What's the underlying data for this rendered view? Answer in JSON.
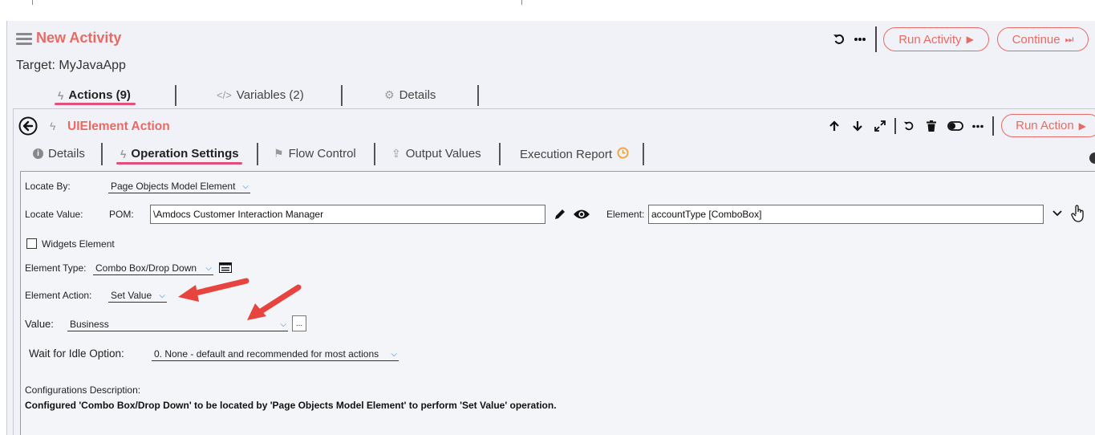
{
  "activity": {
    "title": "New Activity",
    "target": "Target: MyJavaApp",
    "undo_icon": "undo-icon",
    "more_icon": "more-horizontal-icon",
    "run_activity_label": "Run Activity",
    "continue_label": "Continue",
    "tabs": [
      {
        "label": "Actions (9)",
        "icon": "lightning-icon",
        "active": true
      },
      {
        "label": "Variables (2)",
        "icon": "code-icon",
        "active": false
      },
      {
        "label": "Details",
        "icon": "gear-icon",
        "active": false
      }
    ]
  },
  "action": {
    "title": "UIElement Action",
    "run_action_label": "Run Action",
    "toolbar_icons": [
      "arrow-up-icon",
      "arrow-down-icon",
      "expand-icon",
      "undo-icon",
      "trash-icon",
      "toggle-icon",
      "more-horizontal-icon"
    ],
    "tabs": [
      {
        "label": "Details",
        "icon": "info-icon",
        "active": false
      },
      {
        "label": "Operation Settings",
        "icon": "lightning-icon",
        "active": true
      },
      {
        "label": "Flow Control",
        "icon": "signpost-icon",
        "active": false
      },
      {
        "label": "Output Values",
        "icon": "upload-icon",
        "active": false
      },
      {
        "label": "Execution Report",
        "icon": "clock-icon",
        "active": false
      }
    ]
  },
  "form": {
    "locate_by_label": "Locate By:",
    "locate_by_value": "Page Objects Model Element",
    "locate_value_label": "Locate Value:",
    "pom_label": "POM:",
    "pom_value": "\\Amdocs Customer Interaction Manager",
    "element_label": "Element:",
    "element_value": "accountType [ComboBox]",
    "widgets_label": "Widgets Element",
    "widgets_checked": false,
    "element_type_label": "Element Type:",
    "element_type_value": "Combo Box/Drop Down",
    "element_action_label": "Element Action:",
    "element_action_value": "Set Value",
    "value_label": "Value:",
    "value_value": "Business",
    "value_ellipsis": "...",
    "wait_label": "Wait for Idle Option:",
    "wait_value": "0. None - default and recommended for most actions",
    "config_desc_label": "Configurations Description:",
    "config_desc_text": "Configured 'Combo Box/Drop Down' to be located by 'Page Objects Model Element' to perform 'Set Value' operation."
  },
  "colors": {
    "accent": "#e96a64",
    "tab_underline": "#e0507a",
    "chevron": "#1e6fd8",
    "annotation_arrow": "#e8443f",
    "report_clock": "#f2a33a"
  }
}
